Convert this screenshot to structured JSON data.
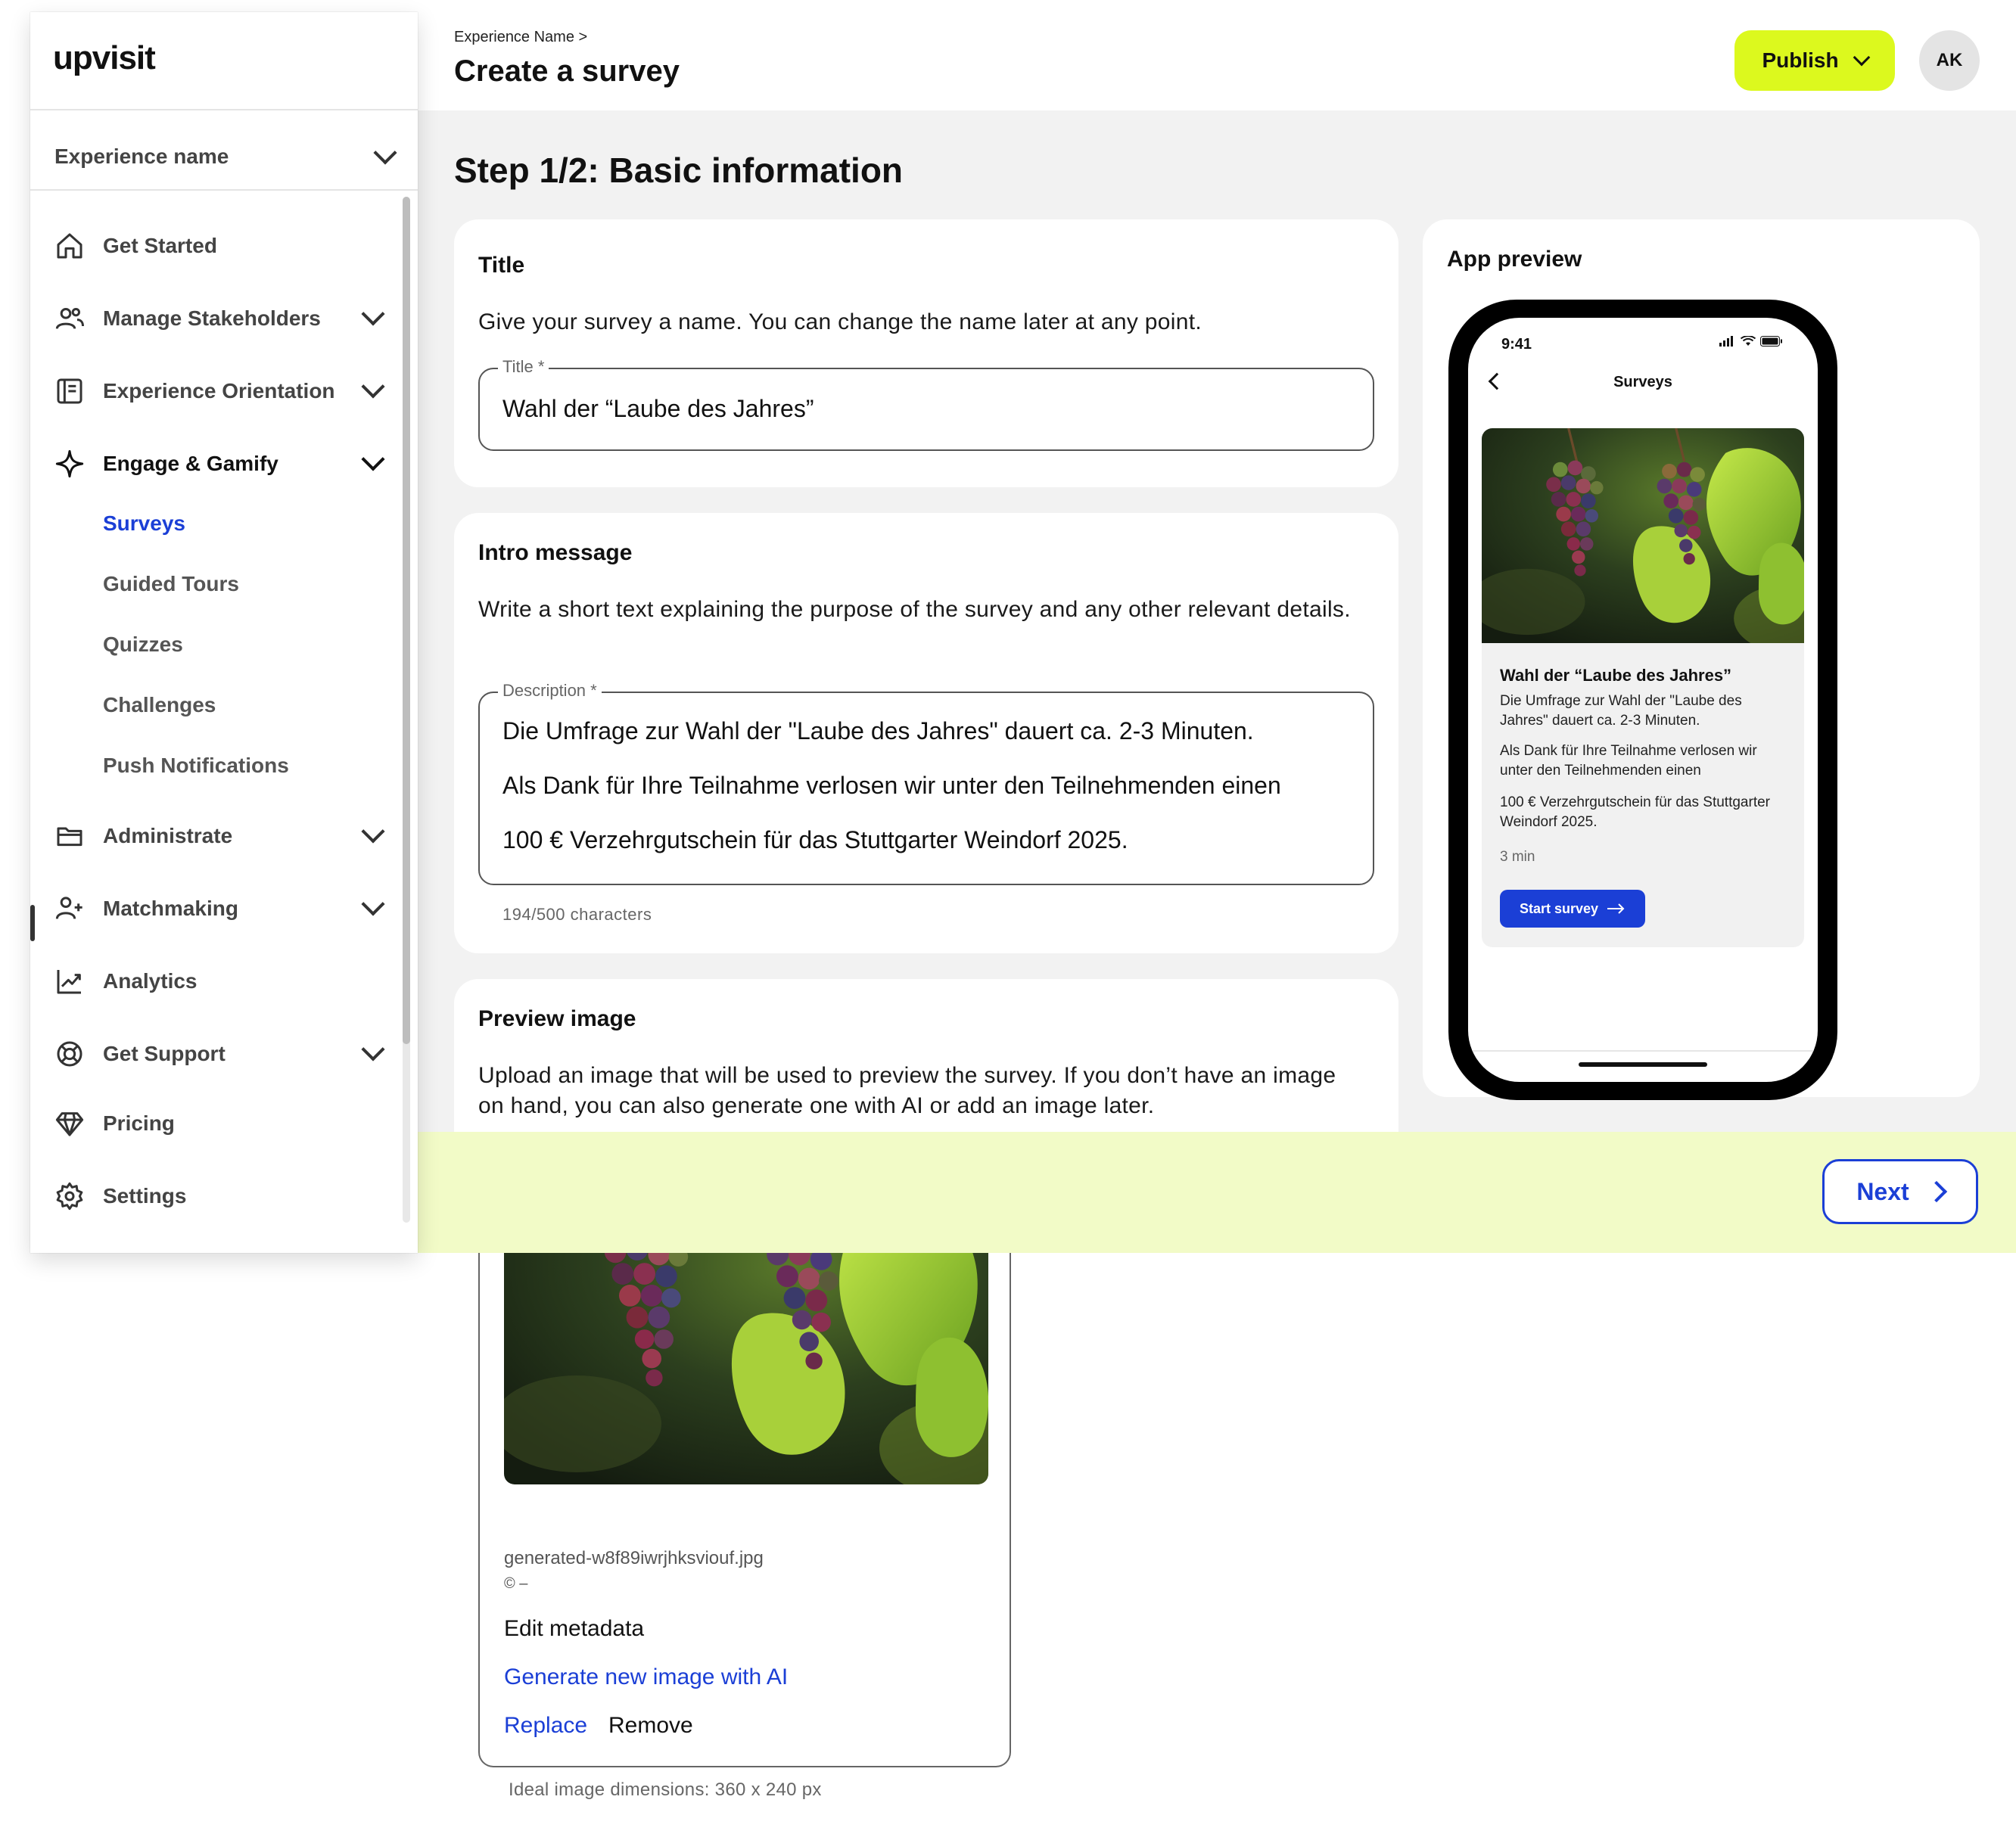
{
  "brand": {
    "logo": "upvisit",
    "accent": "#dcf91e",
    "link_color": "#1b3fd6"
  },
  "sidebar": {
    "experience_selector": "Experience name",
    "items": [
      {
        "label": "Get Started",
        "icon": "home-icon"
      },
      {
        "label": "Manage Stakeholders",
        "icon": "users-icon"
      },
      {
        "label": "Experience Orientation",
        "icon": "book-icon"
      },
      {
        "label": "Engage & Gamify",
        "icon": "sparkle-icon"
      },
      {
        "label": "Administrate",
        "icon": "folder-icon"
      },
      {
        "label": "Matchmaking",
        "icon": "user-plus-icon"
      },
      {
        "label": "Analytics",
        "icon": "chart-line-icon"
      },
      {
        "label": "Get Support",
        "icon": "lifebuoy-icon"
      },
      {
        "label": "Pricing",
        "icon": "diamond-icon"
      },
      {
        "label": "Settings",
        "icon": "gear-icon"
      }
    ],
    "subitems": [
      "Surveys",
      "Guided Tours",
      "Quizzes",
      "Challenges",
      "Push Notifications"
    ],
    "active_subitem": "Surveys"
  },
  "header": {
    "breadcrumb": "Experience Name >",
    "title": "Create a survey",
    "publish_label": "Publish",
    "avatar_initials": "AK"
  },
  "step_title": "Step 1/2: Basic information",
  "title_card": {
    "heading": "Title",
    "description": "Give your survey a name. You can change the name later at any point.",
    "field_label": "Title *",
    "field_value": "Wahl der “Laube des Jahres”"
  },
  "intro_card": {
    "heading": "Intro message",
    "description": "Write a short text explaining the purpose of the survey and any other relevant details.",
    "field_label": "Description *",
    "lines": [
      "Die Umfrage zur Wahl der \"Laube des Jahres\" dauert ca. 2-3 Minuten.",
      "Als Dank für Ihre Teilnahme verlosen wir unter den Teilnehmenden einen",
      "100 € Verzehrgutschein für das Stuttgarter Weindorf 2025."
    ],
    "counter": "194/500 characters"
  },
  "image_card": {
    "heading": "Preview image",
    "description": "Upload an image that will be used to preview the survey. If you don’t have an image on hand, you can also generate one with AI or add an image later.",
    "filename": "generated-w8f89iwrjhksviouf.jpg",
    "copyright": "© –",
    "edit_metadata": "Edit metadata",
    "generate_ai": "Generate new image with AI",
    "replace": "Replace",
    "remove": "Remove",
    "ideal_dimensions": "Ideal image dimensions: 360 x 240 px"
  },
  "app_preview": {
    "heading": "App preview",
    "time": "9:41",
    "screen_title": "Surveys",
    "card_title": "Wahl der “Laube des Jahres”",
    "p1": "Die Umfrage zur Wahl der \"Laube des Jahres\" dauert ca. 2-3 Minuten.",
    "p2": "Als Dank für Ihre Teilnahme verlosen wir unter den Teilnehmenden einen",
    "p3": "100 € Verzehrgutschein für das Stuttgarter Weindorf 2025.",
    "duration": "3 min",
    "start_button": "Start survey"
  },
  "footer": {
    "next_label": "Next"
  }
}
